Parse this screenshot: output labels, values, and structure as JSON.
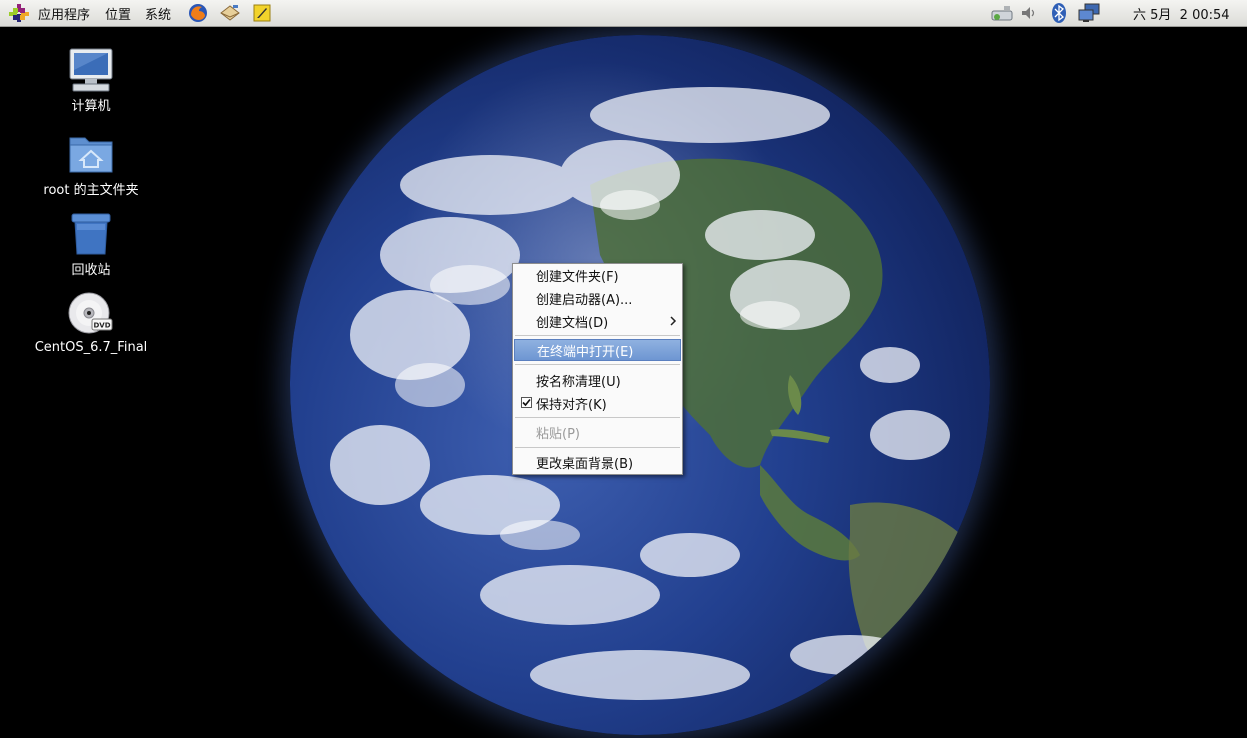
{
  "panel": {
    "menus": {
      "applications": "应用程序",
      "places": "位置",
      "system": "系统"
    },
    "launchers": [
      "firefox-icon",
      "mail-icon",
      "notes-icon"
    ],
    "tray_icons": [
      "network-icon",
      "volume-icon",
      "bluetooth-icon",
      "display-icon"
    ],
    "clock": "六 5月  2 00:54"
  },
  "desktop_icons": [
    {
      "label": "计算机",
      "icon": "computer-icon"
    },
    {
      "label": "root 的主文件夹",
      "icon": "home-folder-icon"
    },
    {
      "label": "回收站",
      "icon": "trash-icon"
    },
    {
      "label": "CentOS_6.7_Final",
      "icon": "dvd-icon"
    }
  ],
  "context_menu": {
    "items": [
      {
        "label": "创建文件夹(F)",
        "enabled": true
      },
      {
        "label": "创建启动器(A)...",
        "enabled": true
      },
      {
        "label": "创建文档(D)",
        "enabled": true,
        "submenu": true
      },
      {
        "label": "在终端中打开(E)",
        "enabled": true,
        "highlighted": true
      },
      {
        "label": "按名称清理(U)",
        "enabled": true
      },
      {
        "label": "保持对齐(K)",
        "enabled": true,
        "checked": true
      },
      {
        "label": "粘贴(P)",
        "enabled": false
      },
      {
        "label": "更改桌面背景(B)",
        "enabled": true
      }
    ]
  },
  "colors": {
    "menu_highlight": "#7aa0d8",
    "desktop_background": "#000000"
  }
}
